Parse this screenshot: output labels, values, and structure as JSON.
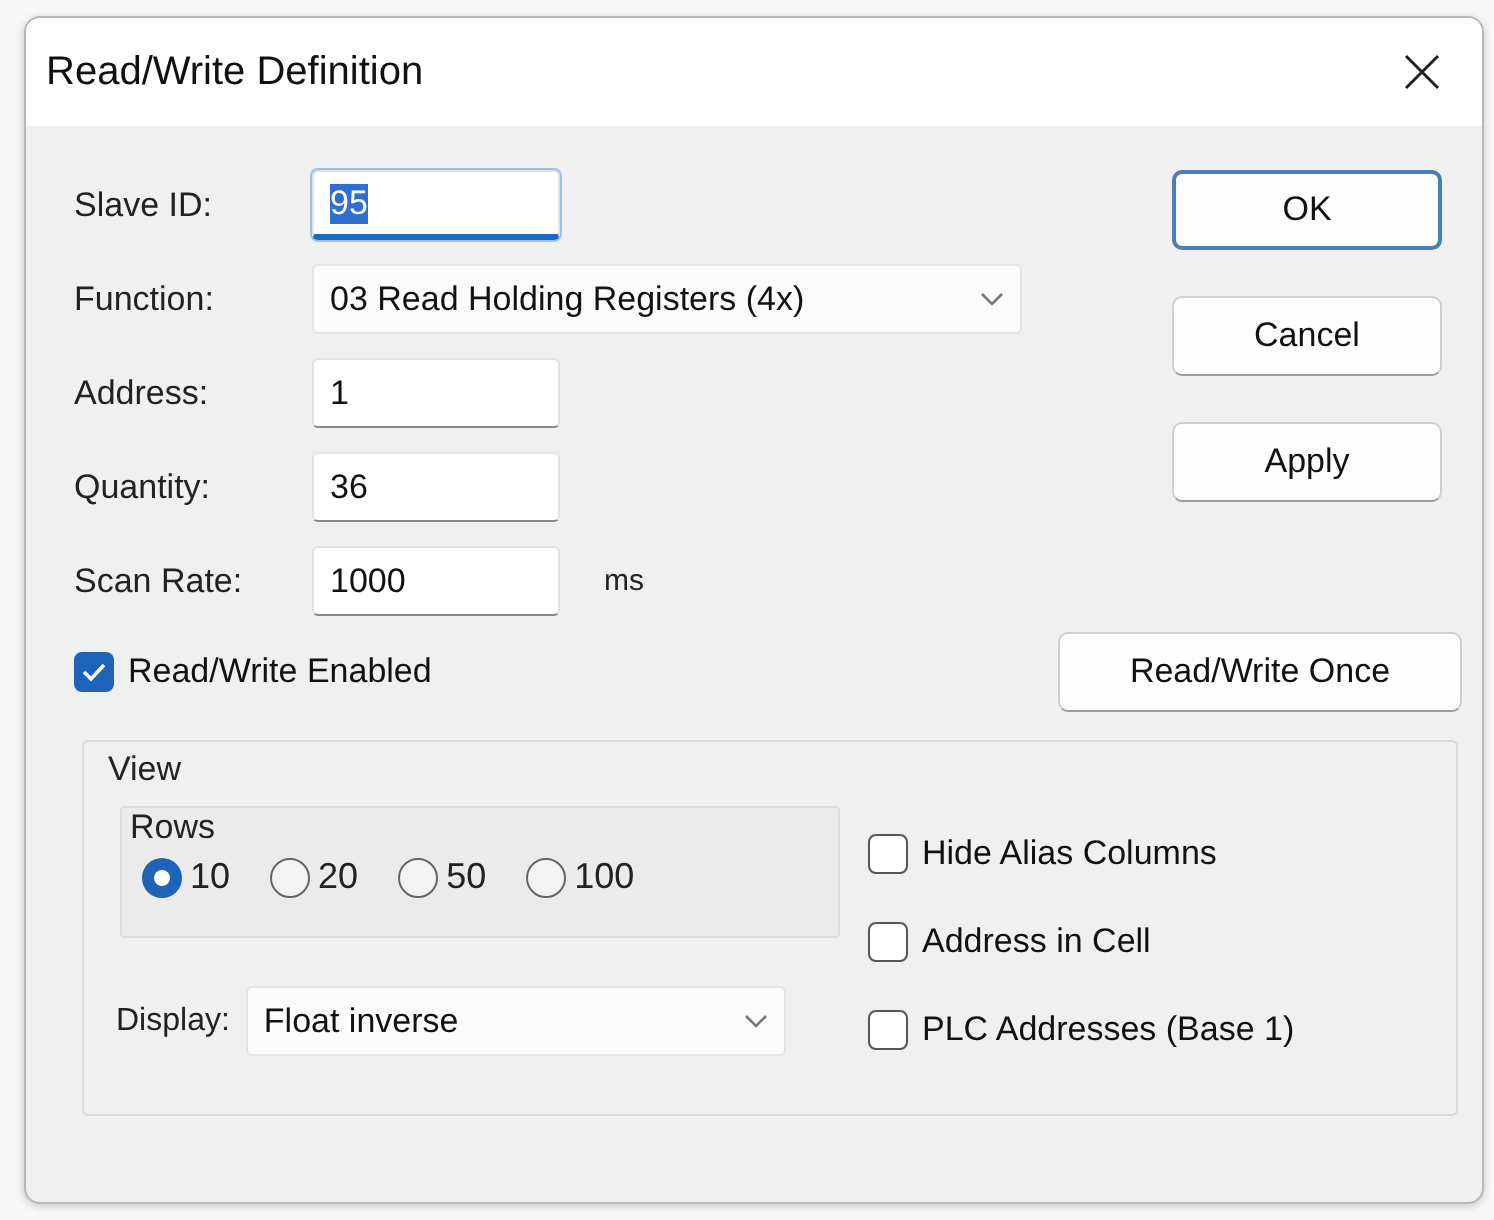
{
  "window": {
    "title": "Read/Write Definition"
  },
  "fields": [
    {
      "label": "Slave ID:",
      "kind": "text",
      "value": "95",
      "focused": true
    },
    {
      "label": "Function:",
      "kind": "dropdown",
      "value": "03 Read Holding Registers (4x)"
    },
    {
      "label": "Address:",
      "kind": "text",
      "value": "1",
      "focused": false
    },
    {
      "label": "Quantity:",
      "kind": "text",
      "value": "36",
      "focused": false
    },
    {
      "label": "Scan Rate:",
      "kind": "text",
      "value": "1000",
      "unit": "ms",
      "focused": false
    }
  ],
  "enabled_checkbox": {
    "label": "Read/Write Enabled",
    "checked": true
  },
  "buttons": [
    {
      "label": "OK",
      "default": true
    },
    {
      "label": "Cancel",
      "default": false
    },
    {
      "label": "Apply",
      "default": false
    }
  ],
  "once_button": {
    "label": "Read/Write Once"
  },
  "view": {
    "title": "View",
    "rows": {
      "title": "Rows",
      "options": [
        {
          "label": "10",
          "selected": true
        },
        {
          "label": "20",
          "selected": false
        },
        {
          "label": "50",
          "selected": false
        },
        {
          "label": "100",
          "selected": false
        }
      ]
    },
    "display": {
      "label": "Display:",
      "value": "Float inverse"
    },
    "options": [
      {
        "label": "Hide Alias Columns",
        "checked": false
      },
      {
        "label": "Address in Cell",
        "checked": false
      },
      {
        "label": "PLC Addresses (Base 1)",
        "checked": false
      }
    ]
  }
}
